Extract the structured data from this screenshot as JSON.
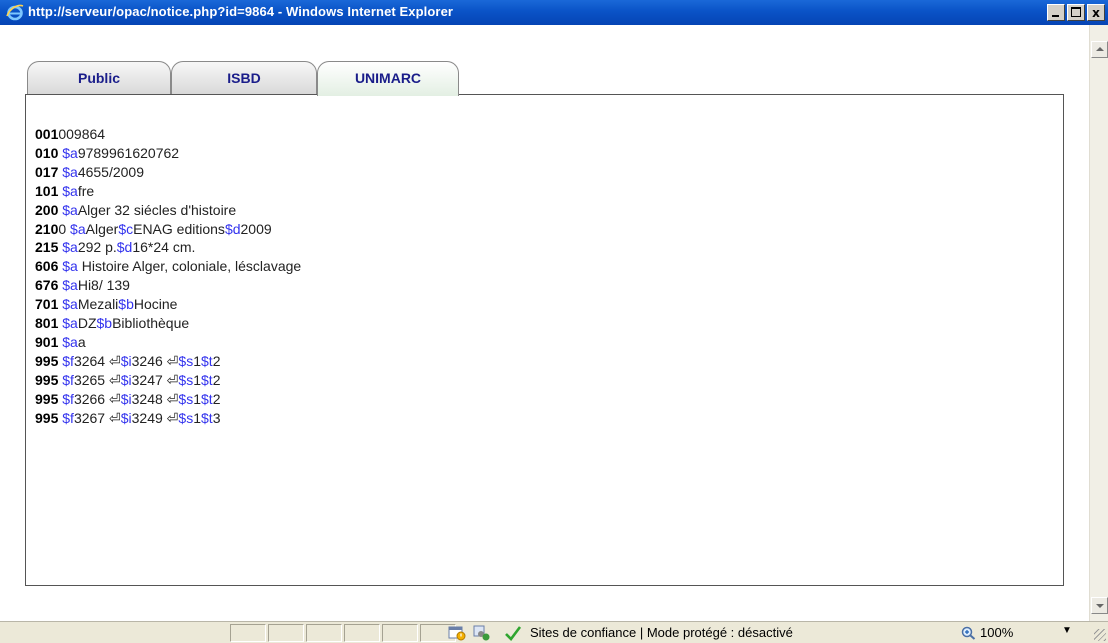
{
  "window": {
    "title": "http://serveur/opac/notice.php?id=9864 - Windows Internet Explorer",
    "buttons": {
      "minimize": "_",
      "maximize": "□",
      "close": "x"
    }
  },
  "tabs": [
    {
      "label": "Public",
      "active": false
    },
    {
      "label": "ISBD",
      "active": false
    },
    {
      "label": "UNIMARC",
      "active": true
    }
  ],
  "record": [
    {
      "tag": "001",
      "parts": [
        {
          "t": "009864",
          "sub": false
        }
      ]
    },
    {
      "tag": "010 ",
      "parts": [
        {
          "t": "$a",
          "sub": true
        },
        {
          "t": "9789961620762",
          "sub": false
        }
      ]
    },
    {
      "tag": "017 ",
      "parts": [
        {
          "t": "$a",
          "sub": true
        },
        {
          "t": "4655/2009",
          "sub": false
        }
      ]
    },
    {
      "tag": "101 ",
      "parts": [
        {
          "t": "$a",
          "sub": true
        },
        {
          "t": "fre",
          "sub": false
        }
      ]
    },
    {
      "tag": "200 ",
      "parts": [
        {
          "t": "$a",
          "sub": true
        },
        {
          "t": "Alger 32 siécles d'histoire",
          "sub": false
        }
      ]
    },
    {
      "tag": "210",
      "parts": [
        {
          "t": "0 ",
          "sub": false
        },
        {
          "t": "$a",
          "sub": true
        },
        {
          "t": "Alger",
          "sub": false
        },
        {
          "t": "$c",
          "sub": true
        },
        {
          "t": "ENAG editions",
          "sub": false
        },
        {
          "t": "$d",
          "sub": true
        },
        {
          "t": "2009",
          "sub": false
        }
      ]
    },
    {
      "tag": "215 ",
      "parts": [
        {
          "t": "$a",
          "sub": true
        },
        {
          "t": "292 p.",
          "sub": false
        },
        {
          "t": "$d",
          "sub": true
        },
        {
          "t": "16*24 cm.",
          "sub": false
        }
      ]
    },
    {
      "tag": "606 ",
      "parts": [
        {
          "t": "$a",
          "sub": true
        },
        {
          "t": " Histoire Alger, coloniale, lésclavage",
          "sub": false
        }
      ]
    },
    {
      "tag": "676 ",
      "parts": [
        {
          "t": "$a",
          "sub": true
        },
        {
          "t": "Hi8/ 139",
          "sub": false
        }
      ]
    },
    {
      "tag": "701 ",
      "parts": [
        {
          "t": "$a",
          "sub": true
        },
        {
          "t": "Mezali",
          "sub": false
        },
        {
          "t": "$b",
          "sub": true
        },
        {
          "t": "Hocine",
          "sub": false
        }
      ]
    },
    {
      "tag": "801 ",
      "parts": [
        {
          "t": "$a",
          "sub": true
        },
        {
          "t": "DZ",
          "sub": false
        },
        {
          "t": "$b",
          "sub": true
        },
        {
          "t": "Bibliothèque",
          "sub": false
        }
      ]
    },
    {
      "tag": "901 ",
      "parts": [
        {
          "t": "$a",
          "sub": true
        },
        {
          "t": "a",
          "sub": false
        }
      ]
    },
    {
      "tag": "995 ",
      "parts": [
        {
          "t": "$f",
          "sub": true
        },
        {
          "t": "3264 ",
          "sub": false
        },
        {
          "t": "⏎",
          "sub": false
        },
        {
          "t": "$i",
          "sub": true
        },
        {
          "t": "3246 ",
          "sub": false
        },
        {
          "t": "⏎",
          "sub": false
        },
        {
          "t": "$s",
          "sub": true
        },
        {
          "t": "1",
          "sub": false
        },
        {
          "t": "$t",
          "sub": true
        },
        {
          "t": "2",
          "sub": false
        }
      ]
    },
    {
      "tag": "995 ",
      "parts": [
        {
          "t": "$f",
          "sub": true
        },
        {
          "t": "3265 ",
          "sub": false
        },
        {
          "t": "⏎",
          "sub": false
        },
        {
          "t": "$i",
          "sub": true
        },
        {
          "t": "3247 ",
          "sub": false
        },
        {
          "t": "⏎",
          "sub": false
        },
        {
          "t": "$s",
          "sub": true
        },
        {
          "t": "1",
          "sub": false
        },
        {
          "t": "$t",
          "sub": true
        },
        {
          "t": "2",
          "sub": false
        }
      ]
    },
    {
      "tag": "995 ",
      "parts": [
        {
          "t": "$f",
          "sub": true
        },
        {
          "t": "3266 ",
          "sub": false
        },
        {
          "t": "⏎",
          "sub": false
        },
        {
          "t": "$i",
          "sub": true
        },
        {
          "t": "3248 ",
          "sub": false
        },
        {
          "t": "⏎",
          "sub": false
        },
        {
          "t": "$s",
          "sub": true
        },
        {
          "t": "1",
          "sub": false
        },
        {
          "t": "$t",
          "sub": true
        },
        {
          "t": "2",
          "sub": false
        }
      ]
    },
    {
      "tag": "995 ",
      "parts": [
        {
          "t": "$f",
          "sub": true
        },
        {
          "t": "3267 ",
          "sub": false
        },
        {
          "t": "⏎",
          "sub": false
        },
        {
          "t": "$i",
          "sub": true
        },
        {
          "t": "3249 ",
          "sub": false
        },
        {
          "t": "⏎",
          "sub": false
        },
        {
          "t": "$s",
          "sub": true
        },
        {
          "t": "1",
          "sub": false
        },
        {
          "t": "$t",
          "sub": true
        },
        {
          "t": "3",
          "sub": false
        }
      ]
    }
  ],
  "statusbar": {
    "zone_text": "Sites de confiance | Mode protégé : désactivé",
    "zoom": "100%",
    "zoom_dropdown": "▼"
  },
  "colors": {
    "titlebar": "#0a53c7",
    "subfield": "#3333ee",
    "tab_text": "#1a1d8a"
  },
  "icons": [
    "ie-logo-icon",
    "security-warning-icon",
    "popup-blocked-icon",
    "trusted-check-icon",
    "zoom-magnifier-icon"
  ]
}
